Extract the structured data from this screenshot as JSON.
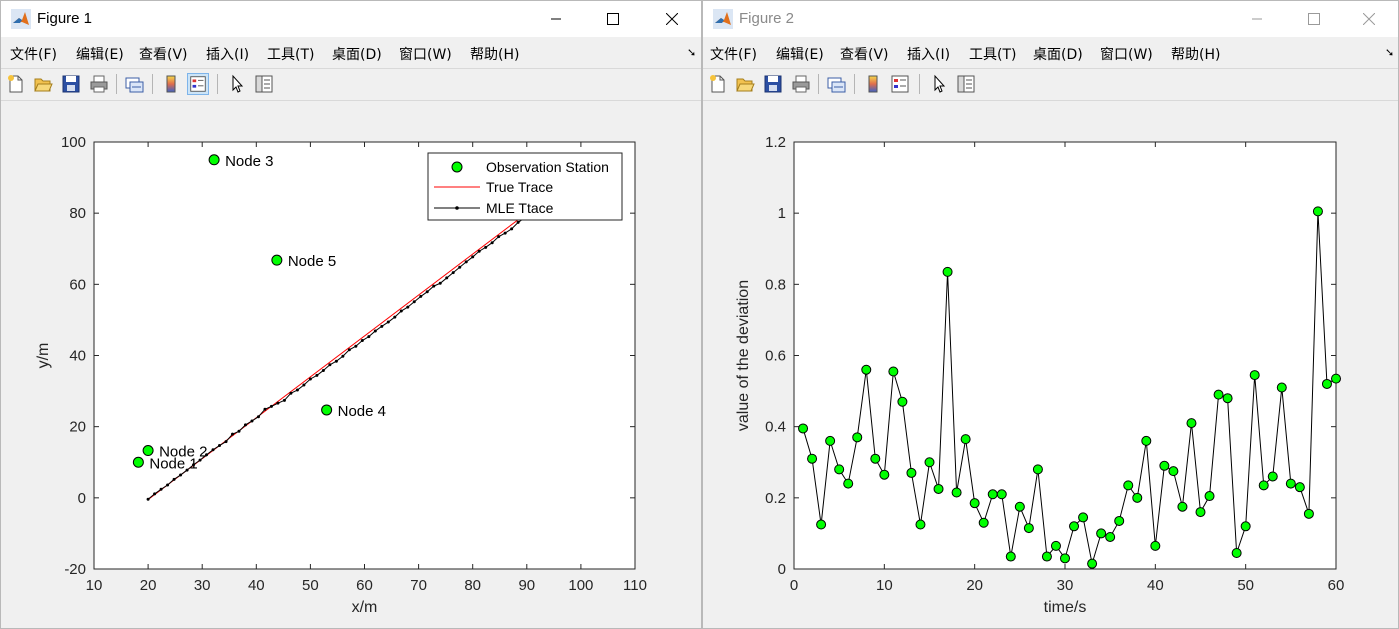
{
  "figure1": {
    "title": "Figure 1",
    "menu": [
      "文件(F)",
      "编辑(E)",
      "查看(V)",
      "插入(I)",
      "工具(T)",
      "桌面(D)",
      "窗口(W)",
      "帮助(H)"
    ],
    "toolbar_icons": [
      "new-figure-icon",
      "open-file-icon",
      "save-icon",
      "print-icon",
      "link-plot-icon",
      "colorbar-icon",
      "legend-icon",
      "edit-plot-arrow-icon",
      "property-inspector-icon"
    ],
    "chart_data": {
      "type": "scatter",
      "xlabel": "x/m",
      "ylabel": "y/m",
      "xlim": [
        10,
        110
      ],
      "ylim": [
        -20,
        100
      ],
      "xticks": [
        10,
        20,
        30,
        40,
        50,
        60,
        70,
        80,
        90,
        100,
        110
      ],
      "yticks": [
        -20,
        0,
        20,
        40,
        60,
        80,
        100
      ],
      "legend": {
        "placement": "top-right",
        "entries": [
          "Observation Station",
          "True Trace",
          "MLE Ttace"
        ]
      },
      "stations": [
        {
          "label": "Node 1",
          "x": 18.2,
          "y": 10
        },
        {
          "label": "Node 2",
          "x": 20,
          "y": 13.3
        },
        {
          "label": "Node 3",
          "x": 32.2,
          "y": 95
        },
        {
          "label": "Node 4",
          "x": 53,
          "y": 24.7
        },
        {
          "label": "Node 5",
          "x": 43.8,
          "y": 66.8
        }
      ],
      "true_trace": {
        "color": "#ff0000",
        "x_start": 20,
        "y_start": -0.5,
        "x_end": 90,
        "y_end": 80
      },
      "mle_trace": {
        "color": "#000000",
        "x": [
          20,
          21.2,
          22.4,
          23.6,
          24.8,
          26,
          27.2,
          28.4,
          29.6,
          30.8,
          32,
          33.2,
          34.4,
          35.6,
          36.8,
          38,
          39.2,
          40.4,
          41.6,
          42.8,
          44,
          45.2,
          46.4,
          47.6,
          48.8,
          50,
          51.2,
          52.4,
          53.6,
          54.8,
          56,
          57.2,
          58.4,
          59.6,
          60.8,
          62,
          63.2,
          64.4,
          65.6,
          66.8,
          68,
          69.2,
          70.4,
          71.6,
          72.8,
          74,
          75.2,
          76.4,
          77.6,
          78.8,
          80,
          81.2,
          82.4,
          83.6,
          84.8,
          86,
          87.2,
          88.4,
          89.6
        ],
        "y": [
          -0.4,
          1.1,
          2.4,
          3.6,
          5.2,
          6.4,
          7.8,
          9.3,
          10.6,
          12.1,
          13.5,
          14.7,
          15.8,
          17.9,
          18.7,
          20.5,
          21.6,
          22.8,
          24.9,
          25.7,
          26.6,
          27.4,
          29.4,
          30.3,
          31.7,
          33.4,
          34.4,
          35.8,
          37.4,
          38.4,
          39.8,
          41.6,
          42.6,
          44.2,
          45.3,
          46.9,
          48.2,
          49.4,
          50.8,
          52.5,
          53.6,
          55.1,
          56.6,
          57.9,
          59.5,
          60.3,
          61.8,
          63.3,
          64.8,
          66.3,
          67.7,
          69.3,
          70.4,
          71.7,
          73.4,
          74.4,
          75.6,
          77.4,
          78.7
        ]
      }
    }
  },
  "figure2": {
    "title": "Figure 2",
    "menu": [
      "文件(F)",
      "编辑(E)",
      "查看(V)",
      "插入(I)",
      "工具(T)",
      "桌面(D)",
      "窗口(W)",
      "帮助(H)"
    ],
    "toolbar_icons": [
      "new-figure-icon",
      "open-file-icon",
      "save-icon",
      "print-icon",
      "link-plot-icon",
      "colorbar-icon",
      "legend-icon",
      "edit-plot-arrow-icon",
      "property-inspector-icon"
    ],
    "chart_data": {
      "type": "line",
      "xlabel": "time/s",
      "ylabel": "value of the deviation",
      "xlim": [
        0,
        60
      ],
      "ylim": [
        0,
        1.2
      ],
      "xticks": [
        0,
        10,
        20,
        30,
        40,
        50,
        60
      ],
      "yticks": [
        0,
        0.2,
        0.4,
        0.6,
        0.8,
        1,
        1.2
      ],
      "marker_color": "#00ff00",
      "x": [
        1,
        2,
        3,
        4,
        5,
        6,
        7,
        8,
        9,
        10,
        11,
        12,
        13,
        14,
        15,
        16,
        17,
        18,
        19,
        20,
        21,
        22,
        23,
        24,
        25,
        26,
        27,
        28,
        29,
        30,
        31,
        32,
        33,
        34,
        35,
        36,
        37,
        38,
        39,
        40,
        41,
        42,
        43,
        44,
        45,
        46,
        47,
        48,
        49,
        50,
        51,
        52,
        53,
        54,
        55,
        56,
        57,
        58,
        59,
        60
      ],
      "y": [
        0.395,
        0.31,
        0.125,
        0.36,
        0.28,
        0.24,
        0.37,
        0.56,
        0.31,
        0.265,
        0.555,
        0.47,
        0.27,
        0.125,
        0.3,
        0.225,
        0.835,
        0.215,
        0.365,
        0.185,
        0.13,
        0.21,
        0.21,
        0.035,
        0.175,
        0.115,
        0.28,
        0.035,
        0.065,
        0.03,
        0.12,
        0.145,
        0.015,
        0.1,
        0.09,
        0.135,
        0.235,
        0.2,
        0.36,
        0.065,
        0.29,
        0.275,
        0.175,
        0.41,
        0.16,
        0.205,
        0.49,
        0.48,
        0.045,
        0.12,
        0.545,
        0.235,
        0.26,
        0.51,
        0.24,
        0.23,
        0.155,
        1.005,
        0.52,
        0.535
      ]
    }
  }
}
